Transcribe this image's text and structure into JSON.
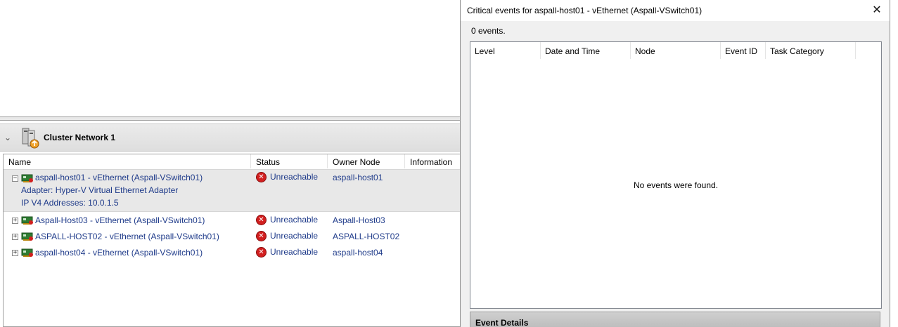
{
  "group": {
    "title": "Cluster Network 1"
  },
  "columns": [
    "Name",
    "Status",
    "Owner Node",
    "Information"
  ],
  "rows": [
    {
      "name": "aspall-host01 - vEthernet (Aspall-VSwitch01)",
      "adapter": "Adapter: Hyper-V Virtual Ethernet Adapter",
      "ip": "IP V4 Addresses: 10.0.1.5",
      "status": "Unreachable",
      "owner": "aspall-host01",
      "expander": "−"
    },
    {
      "name": "Aspall-Host03 - vEthernet (Aspall-VSwitch01)",
      "status": "Unreachable",
      "owner": "Aspall-Host03",
      "expander": "+"
    },
    {
      "name": "ASPALL-HOST02 - vEthernet (Aspall-VSwitch01)",
      "status": "Unreachable",
      "owner": "ASPALL-HOST02",
      "expander": "+"
    },
    {
      "name": "aspall-host04 - vEthernet (Aspall-VSwitch01)",
      "status": "Unreachable",
      "owner": "aspall-host04",
      "expander": "+"
    }
  ],
  "dialog": {
    "title": "Critical events for aspall-host01 - vEthernet (Aspall-VSwitch01)",
    "close_glyph": "✕",
    "count": "0 events.",
    "columns": [
      "Level",
      "Date and Time",
      "Node",
      "Event ID",
      "Task Category"
    ],
    "empty_message": "No events were found.",
    "details_label": "Event Details"
  },
  "icons": {
    "group": "server-cluster-icon",
    "nic": "network-adapter-icon",
    "error": "error-icon",
    "close": "close-icon",
    "collapse": "chevron-down-icon"
  },
  "colors": {
    "link": "#1f3b8a",
    "error": "#d21f1f",
    "selected_row": "#e8e8e8"
  }
}
